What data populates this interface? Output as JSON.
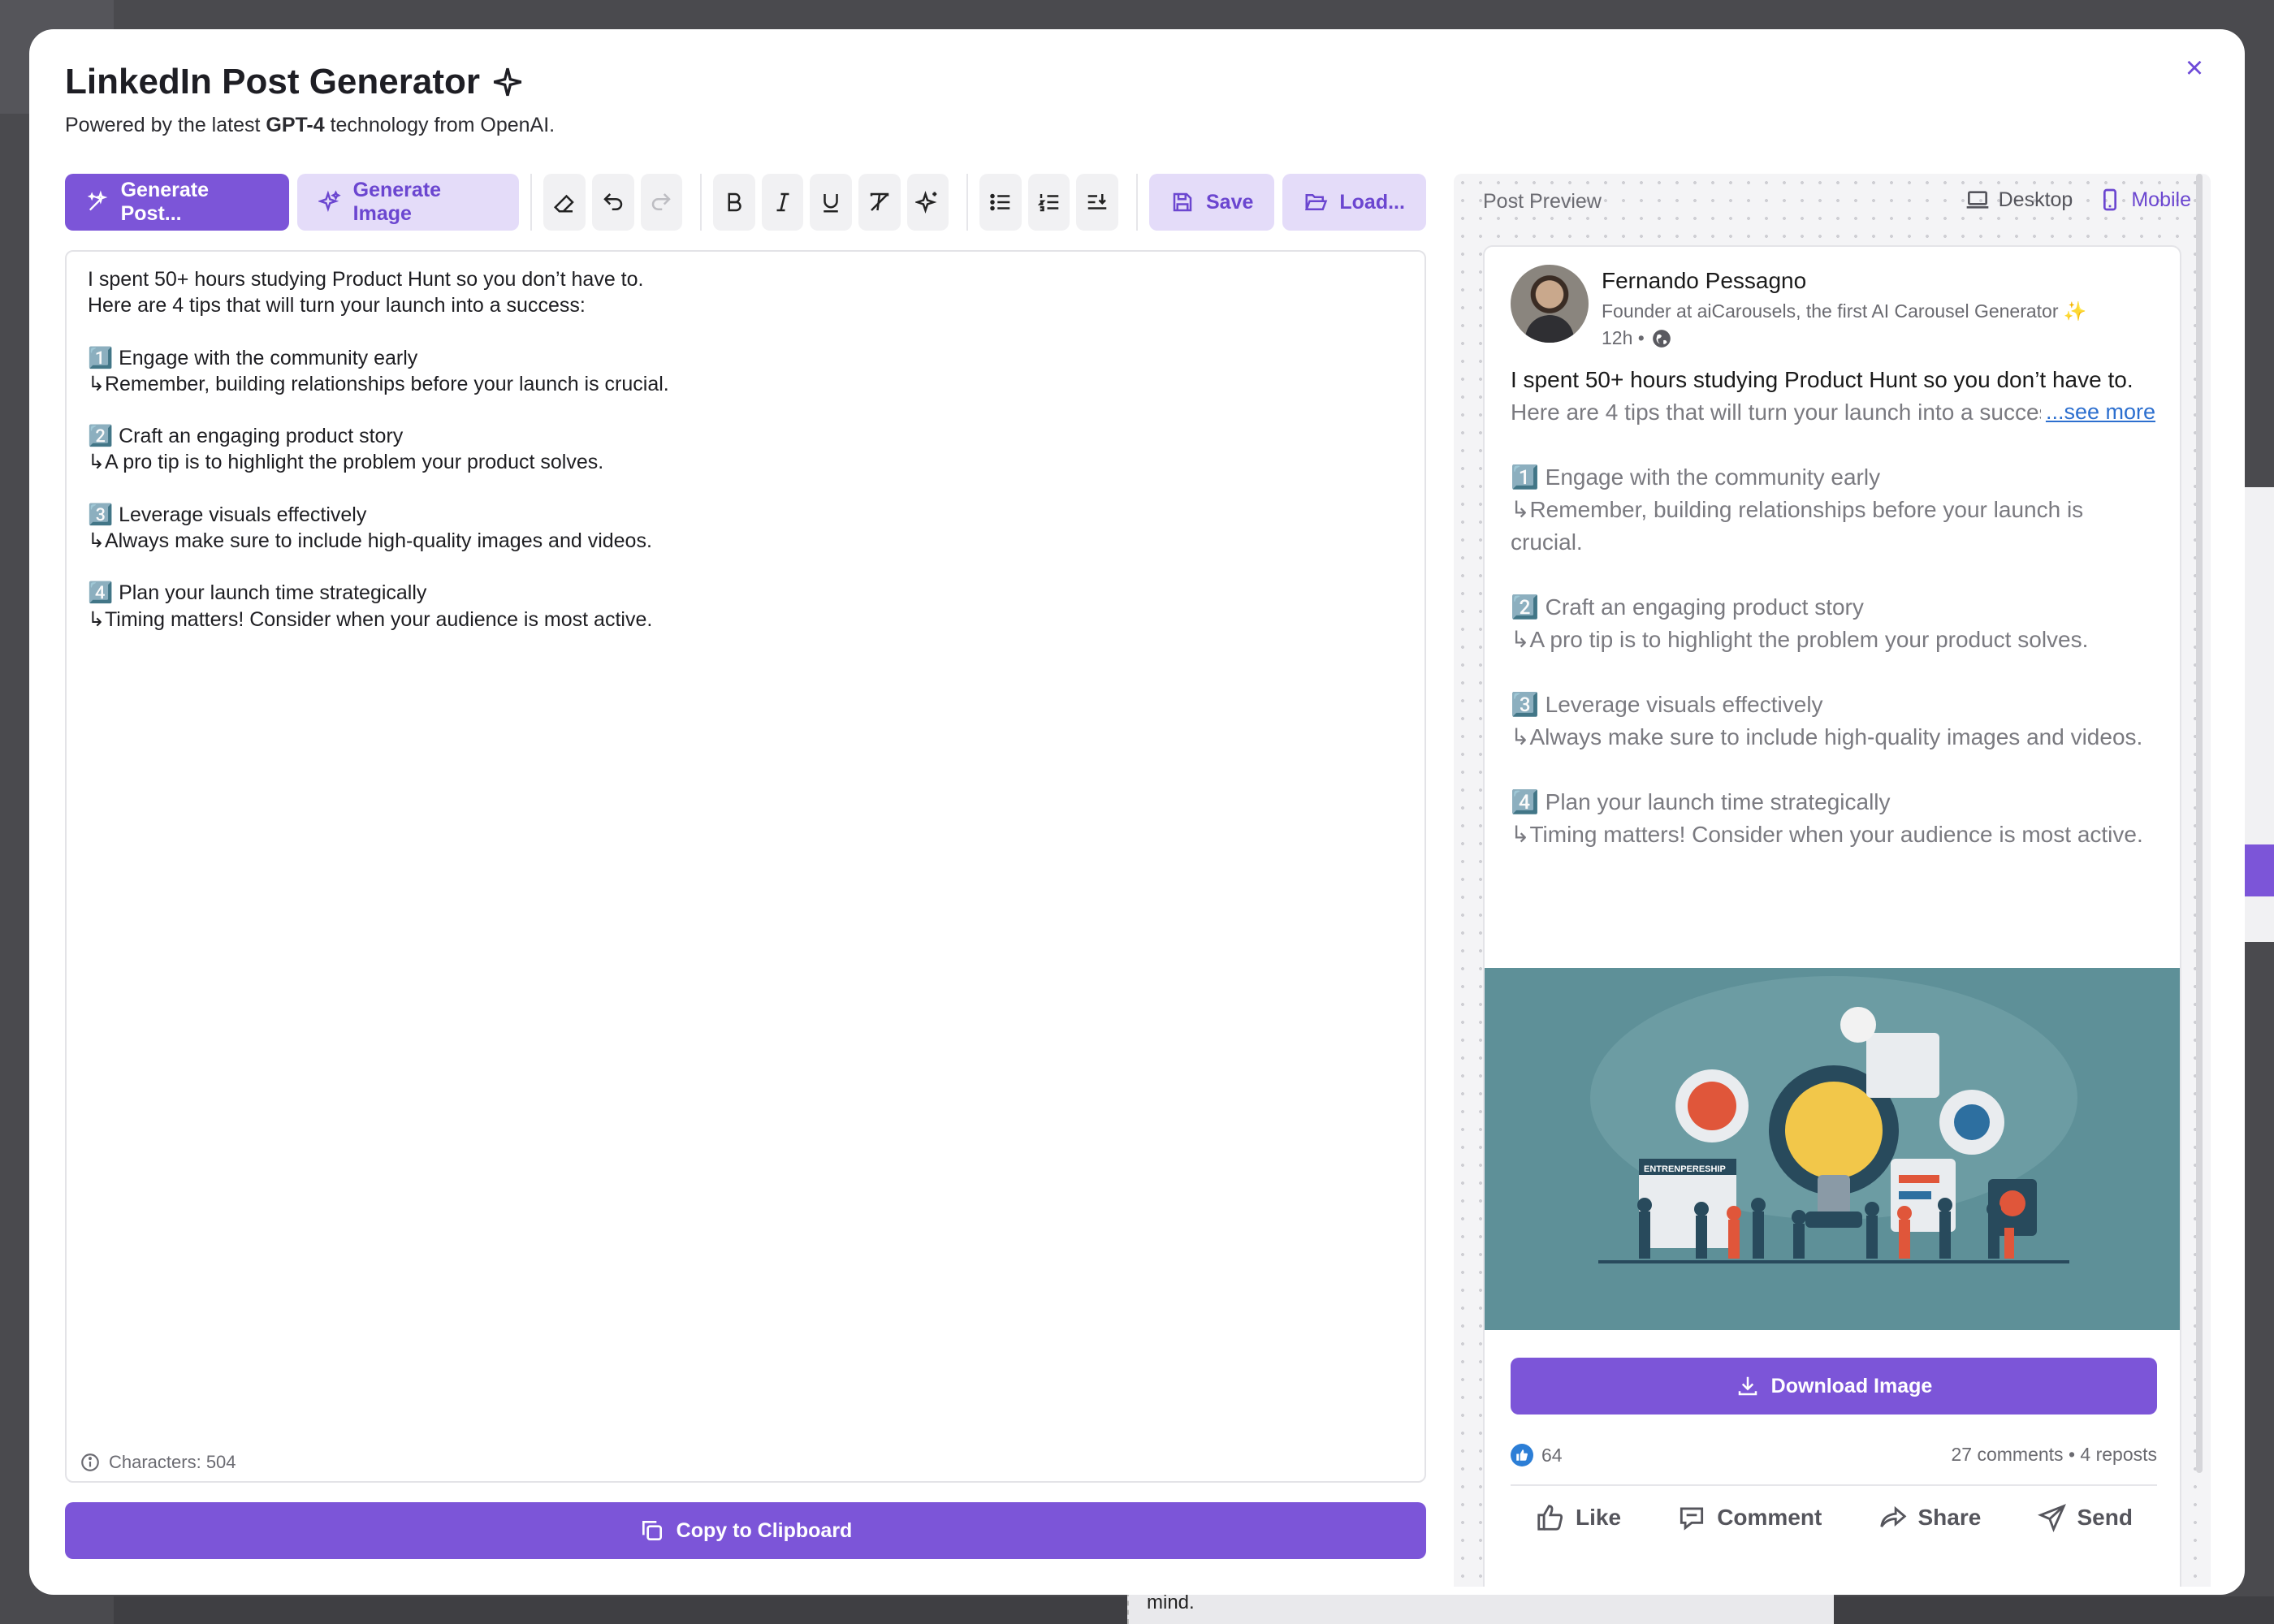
{
  "modal": {
    "title": "LinkedIn Post Generator",
    "subtitle_prefix": "Powered by the latest ",
    "subtitle_bold": "GPT-4",
    "subtitle_suffix": " technology from OpenAI."
  },
  "toolbar": {
    "generate_post": "Generate Post...",
    "generate_image": "Generate Image",
    "save": "Save",
    "load": "Load..."
  },
  "editor": {
    "content": "I spent 50+ hours studying Product Hunt so you don’t have to.\nHere are 4 tips that will turn your launch into a success:\n\n1️⃣ Engage with the community early\n↳Remember, building relationships before your launch is crucial.\n\n2️⃣ Craft an engaging product story\n↳A pro tip is to highlight the problem your product solves.\n\n3️⃣ Leverage visuals effectively\n↳Always make sure to include high-quality images and videos.\n\n4️⃣ Plan your launch time strategically\n↳Timing matters! Consider when your audience is most active.",
    "char_count": "Characters: 504"
  },
  "copy_button": "Copy to Clipboard",
  "preview": {
    "label": "Post Preview",
    "view_desktop": "Desktop",
    "view_mobile": "Mobile",
    "active_view": "Mobile",
    "author_name": "Fernando Pessagno",
    "author_headline": "Founder at aiCarousels, the first AI Carousel Generator ✨",
    "time": "12h •",
    "post_first": "I spent 50+ hours studying Product Hunt so you don’t have to.",
    "post_rest": "Here are 4 tips that will turn your launch into a success:\n\n1️⃣ Engage with the community early\n↳Remember, building relationships before your launch is crucial.\n\n2️⃣ Craft an engaging product story\n↳A pro tip is to highlight the problem your product solves.\n\n3️⃣ Leverage visuals effectively\n↳Always make sure to include high-quality images and videos.\n\n4️⃣ Plan your launch time strategically\n↳Timing matters! Consider when your audience is most active.",
    "see_more": "...see more",
    "image_banner": "ENTRENPERESHIP",
    "download": "Download Image",
    "likes": "64",
    "engagement": "27 comments • 4 reposts",
    "actions": {
      "like": "Like",
      "comment": "Comment",
      "share": "Share",
      "send": "Send"
    }
  },
  "background": {
    "bottom_text": "mind."
  },
  "colors": {
    "accent": "#7c55d8",
    "accent_soft": "#e4dcf9",
    "link": "#2c6fcf"
  }
}
